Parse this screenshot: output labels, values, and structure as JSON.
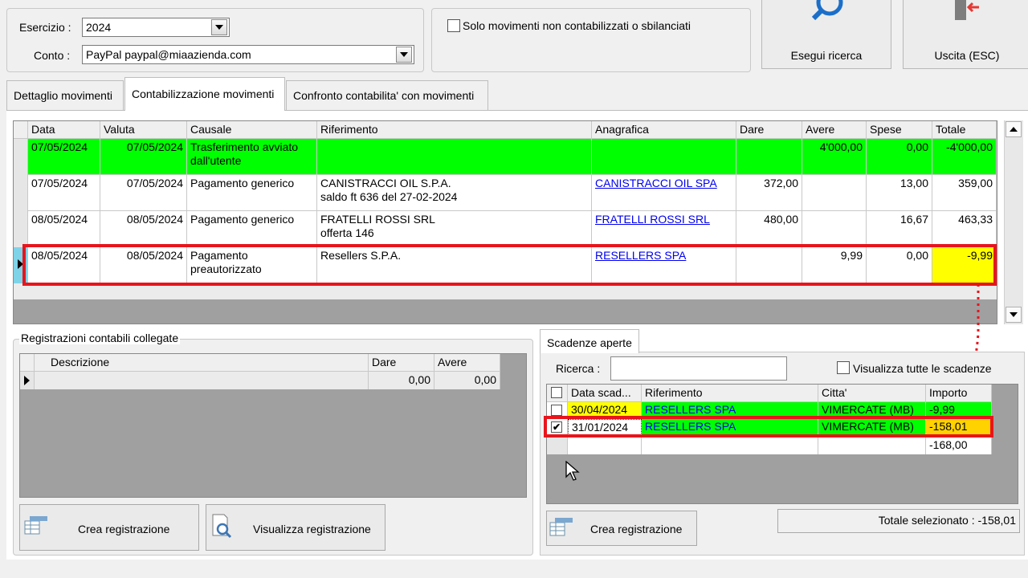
{
  "filters": {
    "esercizio_label": "Esercizio :",
    "esercizio_value": "2024",
    "conto_label": "Conto :",
    "conto_value": "PayPal paypal@miaazienda.com",
    "solo_movimenti_label": "Solo movimenti non contabilizzati o sbilanciati",
    "solo_movimenti_checked": false
  },
  "toolbar": {
    "search_label": "Esegui ricerca",
    "exit_label": "Uscita (ESC)"
  },
  "tabs": [
    {
      "label": "Dettaglio movimenti",
      "active": false
    },
    {
      "label": "Contabilizzazione movimenti",
      "active": true
    },
    {
      "label": "Confronto contabilita' con movimenti",
      "active": false
    }
  ],
  "movements": {
    "columns": [
      "Data",
      "Valuta",
      "Causale",
      "Riferimento",
      "Anagrafica",
      "Dare",
      "Avere",
      "Spese",
      "Totale"
    ],
    "rows": [
      {
        "data": "07/05/2024",
        "valuta": "07/05/2024",
        "causale": "Trasferimento avviato dall'utente",
        "riferimento": "",
        "anagrafica": "",
        "dare": "",
        "avere": "4'000,00",
        "spese": "0,00",
        "totale": "-4'000,00"
      },
      {
        "data": "07/05/2024",
        "valuta": "07/05/2024",
        "causale": "Pagamento generico",
        "riferimento": "CANISTRACCI OIL S.P.A.\nsaldo ft 636 del 27-02-2024",
        "anagrafica": "CANISTRACCI OIL SPA",
        "dare": "372,00",
        "avere": "",
        "spese": "13,00",
        "totale": "359,00"
      },
      {
        "data": "08/05/2024",
        "valuta": "08/05/2024",
        "causale": "Pagamento generico",
        "riferimento": "FRATELLI ROSSI SRL\nofferta 146",
        "anagrafica": "FRATELLI ROSSI SRL",
        "dare": "480,00",
        "avere": "",
        "spese": "16,67",
        "totale": "463,33"
      },
      {
        "data": "08/05/2024",
        "valuta": "08/05/2024",
        "causale": "Pagamento preautorizzato",
        "riferimento": "Resellers S.P.A.",
        "anagrafica": "RESELLERS SPA",
        "dare": "",
        "avere": "9,99",
        "spese": "0,00",
        "totale": "-9,99"
      }
    ]
  },
  "registrazioni": {
    "title": "Registrazioni contabili collegate",
    "columns": [
      "Descrizione",
      "Dare",
      "Avere"
    ],
    "row": {
      "descrizione": "",
      "dare": "0,00",
      "avere": "0,00"
    },
    "crea_label": "Crea registrazione",
    "visualizza_label": "Visualizza registrazione"
  },
  "scadenze": {
    "tab_label": "Scadenze aperte",
    "ricerca_label": "Ricerca :",
    "ricerca_value": "",
    "visualizza_tutte_label": "Visualizza tutte le scadenze",
    "columns": [
      "Data scad...",
      "Riferimento",
      "Citta'",
      "Importo"
    ],
    "rows": [
      {
        "checked": false,
        "data": "30/04/2024",
        "riferimento": "RESELLERS SPA",
        "citta": "VIMERCATE (MB)",
        "importo": "-9,99"
      },
      {
        "checked": true,
        "data": "31/01/2024",
        "riferimento": "RESELLERS SPA",
        "citta": "VIMERCATE (MB)",
        "importo": "-158,01"
      }
    ],
    "total_row": "-168,00",
    "crea_label": "Crea registrazione",
    "totale_selezionato": "Totale selezionato : -158,01"
  },
  "colors": {
    "highlight_green": "#00ff00",
    "highlight_yellow": "#ffff00",
    "annotation_red": "#e8141c"
  }
}
